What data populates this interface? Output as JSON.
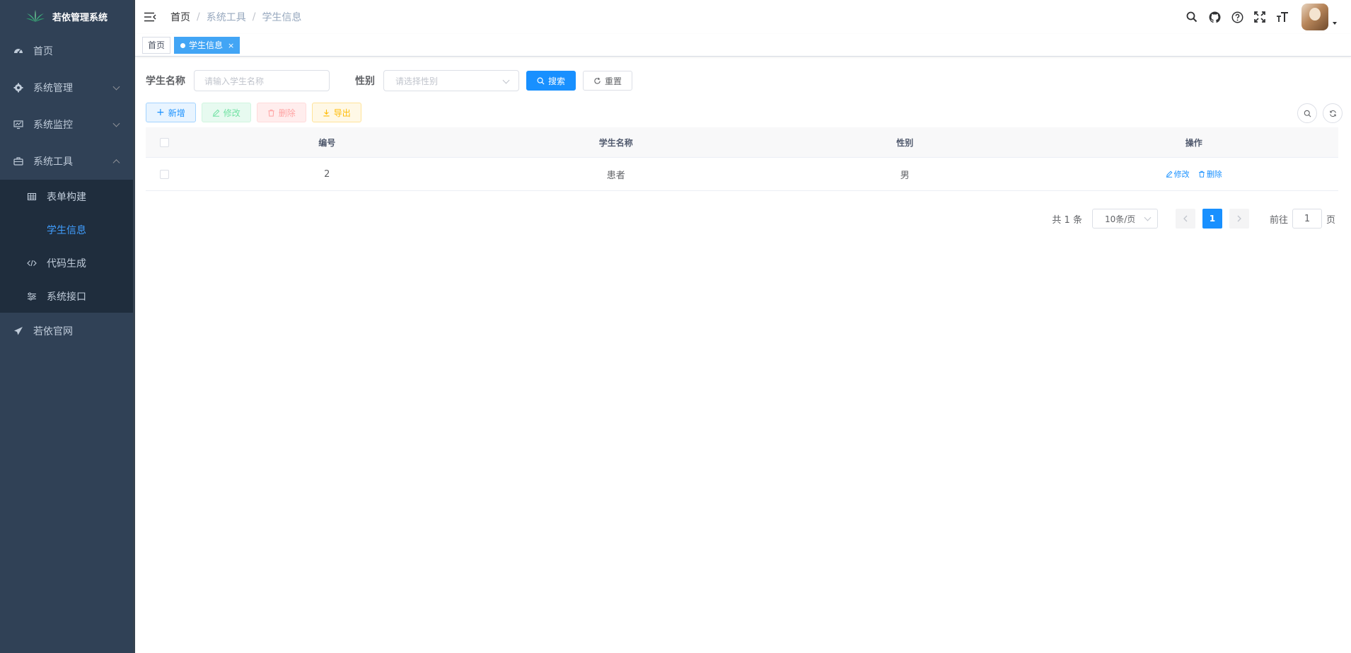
{
  "app": {
    "title": "若依管理系统"
  },
  "sidebar": {
    "items": [
      {
        "label": "首页",
        "icon": "dashboard-icon"
      },
      {
        "label": "系统管理",
        "icon": "gear-icon"
      },
      {
        "label": "系统监控",
        "icon": "monitor-icon"
      },
      {
        "label": "系统工具",
        "icon": "toolbox-icon"
      },
      {
        "label": "若依官网",
        "icon": "paper-plane-icon"
      }
    ],
    "tool_children": [
      {
        "label": "表单构建",
        "icon": "table-grid-icon"
      },
      {
        "label": "学生信息",
        "icon": ""
      },
      {
        "label": "代码生成",
        "icon": "code-icon"
      },
      {
        "label": "系统接口",
        "icon": "sliders-icon"
      }
    ]
  },
  "breadcrumb": [
    "首页",
    "系统工具",
    "学生信息"
  ],
  "tags": [
    {
      "label": "首页"
    },
    {
      "label": "学生信息",
      "close": "×"
    }
  ],
  "search": {
    "name_label": "学生名称",
    "name_placeholder": "请输入学生名称",
    "gender_label": "性别",
    "gender_placeholder": "请选择性别",
    "search_button": "搜索",
    "reset_button": "重置"
  },
  "toolbar": {
    "add": "新增",
    "edit": "修改",
    "delete": "删除",
    "export": "导出"
  },
  "table": {
    "columns": [
      "编号",
      "学生名称",
      "性别",
      "操作"
    ],
    "rows": [
      {
        "id": "2",
        "name": "患者",
        "gender": "男",
        "edit": "修改",
        "delete": "删除"
      }
    ]
  },
  "pagination": {
    "total": "共 1 条",
    "page_size": "10条/页",
    "current": "1",
    "goto_label": "前往",
    "goto_value": "1",
    "page_suffix": "页"
  },
  "colors": {
    "sidebar_bg": "#304156",
    "submenu_bg": "#1f2d3d",
    "primary": "#1890ff",
    "active_menu": "#409eff"
  }
}
